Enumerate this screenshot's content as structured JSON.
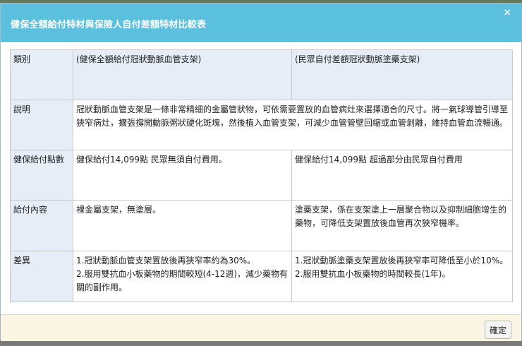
{
  "dialog": {
    "title": "健保全額給付特材與保險人自付差額特材比較表",
    "close_icon": "×",
    "ok_label": "確定"
  },
  "table": {
    "header": [
      "類別",
      "(健保全額給付冠狀動脈血管支架)",
      "(民眾自付差額冠狀動脈塗藥支架)"
    ],
    "rows": [
      {
        "label": "說明",
        "merged": "冠狀動脈血管支架是一條非常精細的金屬管狀物，可依需要置放的血管病灶來選擇適合的尺寸。將一氣球導管引導至狹窄病灶，擴張撐開動脈粥狀硬化斑塊，然後植入血管支架，可減少血管管壁回縮或血管剝離，維持血管血流暢通。"
      },
      {
        "label": "健保給付點數",
        "col1": "健保給付14,099點 民眾無須自付費用。",
        "col2": "健保給付14,099點 超過部分由民眾自付費用"
      },
      {
        "label": "給付內容",
        "col1": "裸金屬支架，無塗層。",
        "col2": "塗藥支架，係在支架塗上一層聚合物以及抑制細胞增生的藥物，可降低支架置放後血管再次狹窄機率。"
      },
      {
        "label": "差異",
        "col1_line1": "1.冠狀動脈血管支架置放後再狹窄率約為30%。",
        "col1_line2": "2.服用雙抗血小板藥物的期間較短(4-12週)，減少藥物有關的副作用。",
        "col2_line1": "1.冠狀動脈塗藥支架置放後再狹窄率可降低至小於10%。",
        "col2_line2": "2.服用雙抗血小板藥物的時間較長(1年)。"
      }
    ]
  }
}
